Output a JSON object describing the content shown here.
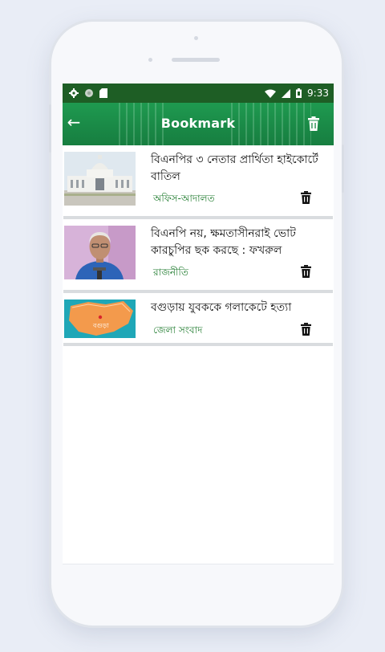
{
  "status_bar": {
    "time": "9:33"
  },
  "app_bar": {
    "title": "Bookmark"
  },
  "bookmarks": [
    {
      "headline": "বিএনপির ৩ নেতার প্রার্থিতা হাইকোর্টে বাতিল",
      "category": "অফিস-আদালত",
      "image": "court-building-image"
    },
    {
      "headline": "বিএনপি নয়, ক্ষমতাসীনরাই ভোট কারচুপির ছক করছে : ফখরুল",
      "category": "রাজনীতি",
      "image": "speaker-portrait-image"
    },
    {
      "headline": "বগুড়ায় যুবককে গলাকেটে হত্যা",
      "category": "জেলা সংবাদ",
      "image": "bogura-map-image",
      "map_label": "বগুড়া"
    }
  ],
  "colors": {
    "status_bar": "#1e5e25",
    "app_bar": "#1a8a47",
    "category_text": "#1d7a2c"
  }
}
